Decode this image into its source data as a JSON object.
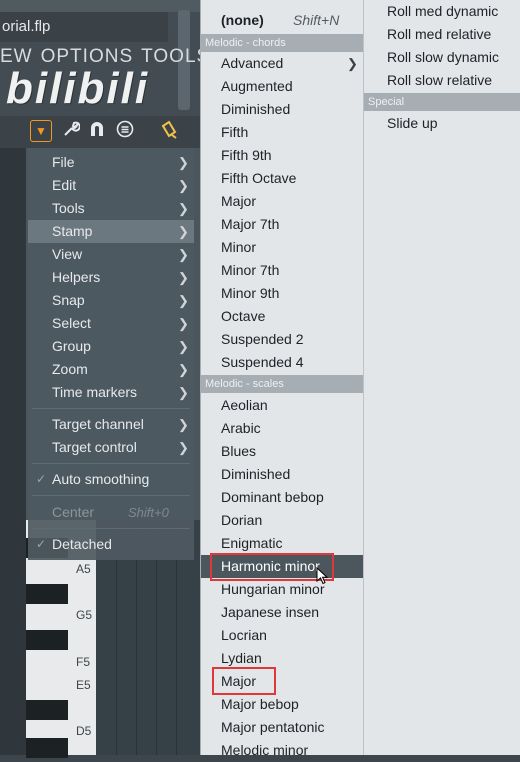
{
  "app": {
    "title": "orial.flp",
    "menu_bar": [
      "EW",
      "OPTIONS",
      "TOOLS",
      "?"
    ],
    "logo_text": "bilibili",
    "toolbar_icons": [
      "dropdown-menu-icon",
      "wrench-icon",
      "magnet-icon",
      "list-icon",
      "stamp-icon"
    ],
    "note_labels": [
      "A5",
      "G5",
      "F5",
      "E5",
      "D5"
    ]
  },
  "context_menu": {
    "items": [
      {
        "label": "File",
        "submenu": true
      },
      {
        "label": "Edit",
        "submenu": true
      },
      {
        "label": "Tools",
        "submenu": true
      },
      {
        "label": "Stamp",
        "submenu": true,
        "active": true
      },
      {
        "label": "View",
        "submenu": true
      },
      {
        "label": "Helpers",
        "submenu": true
      },
      {
        "label": "Snap",
        "submenu": true
      },
      {
        "label": "Select",
        "submenu": true
      },
      {
        "label": "Group",
        "submenu": true
      },
      {
        "label": "Zoom",
        "submenu": true
      },
      {
        "label": "Time markers",
        "submenu": true
      },
      {
        "label": "Target channel",
        "submenu": true
      },
      {
        "label": "Target control",
        "submenu": true
      },
      {
        "label": "Auto smoothing",
        "checked": true
      },
      {
        "label": "Center",
        "shortcut": "Shift+0",
        "disabled": true
      },
      {
        "label": "Detached",
        "checked": true
      }
    ]
  },
  "stamp_menu": {
    "none_label": "(none)",
    "none_shortcut": "Shift+N",
    "header_chords": "Melodic - chords",
    "chords": [
      "Advanced",
      "Augmented",
      "Diminished",
      "Fifth",
      "Fifth 9th",
      "Fifth Octave",
      "Major",
      "Major 7th",
      "Minor",
      "Minor 7th",
      "Minor 9th",
      "Octave",
      "Suspended 2",
      "Suspended 4"
    ],
    "header_scales": "Melodic - scales",
    "scales": [
      "Aeolian",
      "Arabic",
      "Blues",
      "Diminished",
      "Dominant bebop",
      "Dorian",
      "Enigmatic",
      "Harmonic minor",
      "Hungarian minor",
      "Japanese insen",
      "Locrian",
      "Lydian",
      "Major",
      "Major bebop",
      "Major pentatonic",
      "Melodic minor"
    ],
    "hovered_item": "Harmonic minor"
  },
  "stamp_menu_right": {
    "items": [
      "Roll med dynamic",
      "Roll med relative",
      "Roll slow dynamic",
      "Roll slow relative"
    ],
    "header_special": "Special",
    "special_items": [
      "Slide up"
    ]
  },
  "colors": {
    "accent_orange": "#f29a1a",
    "highlight_red": "#e03838",
    "hover_bg": "#4b565d",
    "menu_bg": "#e3e6e9"
  }
}
